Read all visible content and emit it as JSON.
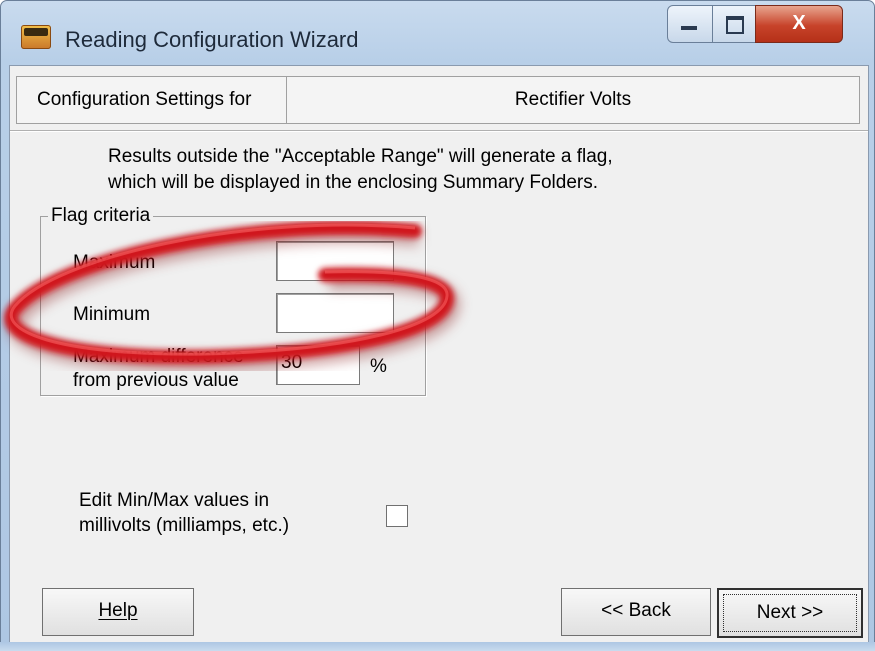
{
  "window": {
    "title": "Reading Configuration Wizard",
    "min_glyph": "—",
    "max_glyph": "□",
    "close_glyph": "X"
  },
  "header": {
    "left_label": "Configuration Settings for",
    "right_label": "Rectifier Volts"
  },
  "info": {
    "line1": "Results outside the \"Acceptable Range\" will generate a flag,",
    "line2": "which will be displayed in the enclosing Summary Folders."
  },
  "flag_criteria": {
    "title": "Flag criteria",
    "maximum_label": "Maximum",
    "maximum_value": "",
    "minimum_label": "Minimum",
    "minimum_value": "",
    "max_diff_label_1": "Maximum difference",
    "max_diff_label_2": "from previous value",
    "max_diff_value": "30",
    "percent": "%"
  },
  "millivolts": {
    "label_1": "Edit Min/Max values in",
    "label_2": "millivolts (milliamps, etc.)",
    "checked": false
  },
  "buttons": {
    "help": "Help",
    "back": "<< Back",
    "next": "Next >>"
  },
  "colors": {
    "highlight": "#d0141c",
    "titlebar": "#b8cfe8",
    "client": "#f0f0f0",
    "close_button": "#c7432a"
  },
  "icons": {
    "app": "app-logo-icon",
    "minimize": "minimize-icon",
    "maximize": "maximize-icon",
    "close": "close-icon"
  }
}
